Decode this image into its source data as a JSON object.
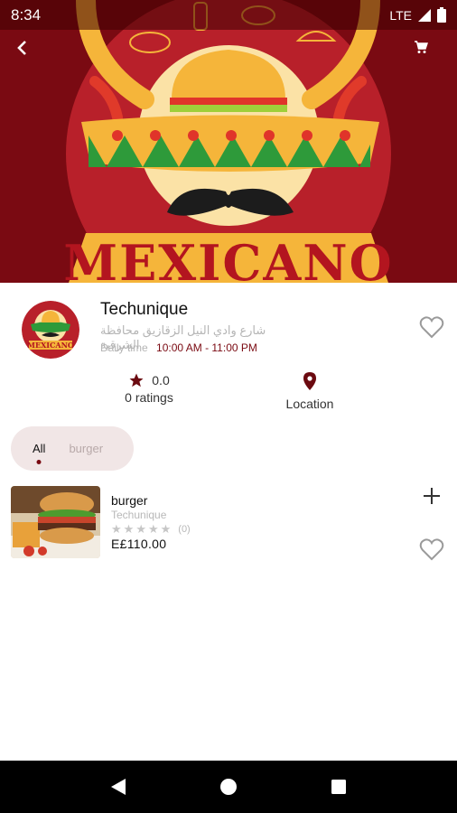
{
  "status_bar": {
    "time": "8:34",
    "network": "LTE"
  },
  "hero": {
    "banner_text": "MEXICANO",
    "logo_text": "MEXICANO"
  },
  "restaurant": {
    "name": "Techunique",
    "address": "شارع وادي النيل الزقازيق محافظة الشرقية",
    "daily_time_label": "Daily time",
    "hours": "10:00 AM - 11:00 PM",
    "rating_value": "0.0",
    "ratings_label": "0 ratings",
    "location_label": "Location"
  },
  "tabs": [
    {
      "label": "All",
      "active": true
    },
    {
      "label": "burger",
      "active": false
    }
  ],
  "products": [
    {
      "name": "burger",
      "restaurant": "Techunique",
      "rating_count": "(0)",
      "price": "E£110.00",
      "stars": 5
    }
  ],
  "colors": {
    "brand": "#7a0a12",
    "tab_bg": "#f1e6e6",
    "muted": "#b5b5b5"
  },
  "icons": {
    "back": "chevron-left-icon",
    "cart": "cart-icon",
    "favorite": "heart-outline-icon",
    "star": "star-icon",
    "location": "map-pin-icon",
    "add": "plus-icon"
  }
}
